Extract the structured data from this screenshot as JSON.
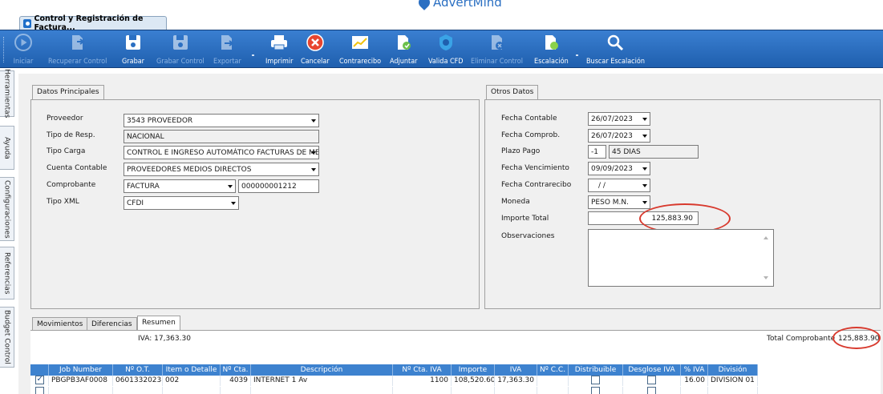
{
  "brand": {
    "logo_text": "AdvertMind"
  },
  "window": {
    "tab_title": "Control y Registración de Factura..."
  },
  "toolbar": {
    "buttons": [
      {
        "label": "Iniciar",
        "icon": "play-icon",
        "enabled": false
      },
      {
        "label": "Recuperar Control",
        "icon": "recover-document-icon",
        "enabled": false
      },
      {
        "label": "Grabar",
        "icon": "save-icon",
        "enabled": true
      },
      {
        "label": "Grabar Control",
        "icon": "save-control-icon",
        "enabled": false
      },
      {
        "label": "Exportar",
        "icon": "export-icon",
        "enabled": false
      },
      {
        "label": "Imprimir",
        "icon": "printer-icon",
        "enabled": true
      },
      {
        "label": "Cancelar",
        "icon": "cancel-icon",
        "enabled": true
      },
      {
        "label": "Contrarecibo",
        "icon": "receipt-chart-icon",
        "enabled": true
      },
      {
        "label": "Adjuntar",
        "icon": "attach-document-icon",
        "enabled": true
      },
      {
        "label": "Valida CFD",
        "icon": "validate-cfd-icon",
        "enabled": true
      },
      {
        "label": "Eliminar Control",
        "icon": "delete-document-icon",
        "enabled": false
      },
      {
        "label": "Escalación",
        "icon": "escalation-icon",
        "enabled": true
      },
      {
        "label": "Buscar Escalación",
        "icon": "search-icon",
        "enabled": true
      }
    ]
  },
  "side_tabs": [
    "Herramientas",
    "Ayuda",
    "Configuraciones",
    "Referencias",
    "Budget Control"
  ],
  "datos_principales": {
    "title": "Datos Principales",
    "proveedor": {
      "label": "Proveedor",
      "value": "3543 PROVEEDOR"
    },
    "tipo_resp": {
      "label": "Tipo de Resp.",
      "value": "NACIONAL"
    },
    "tipo_carga": {
      "label": "Tipo Carga",
      "value": "CONTROL E INGRESO AUTOMÁTICO FACTURAS DE MED"
    },
    "cuenta_contable": {
      "label": "Cuenta Contable",
      "value": "PROVEEDORES MEDIOS DIRECTOS"
    },
    "comprobante": {
      "label": "Comprobante",
      "value": "FACTURA",
      "number": "000000001212"
    },
    "tipo_xml": {
      "label": "Tipo XML",
      "value": "CFDI"
    }
  },
  "otros_datos": {
    "title": "Otros Datos",
    "fecha_contable": {
      "label": "Fecha Contable",
      "value": "26/07/2023"
    },
    "fecha_comprob": {
      "label": "Fecha Comprob.",
      "value": "26/07/2023"
    },
    "plazo_pago": {
      "label": "Plazo Pago",
      "code": "-1",
      "value": "45 DIAS"
    },
    "fecha_vencimiento": {
      "label": "Fecha Vencimiento",
      "value": "09/09/2023"
    },
    "fecha_contrarecibo": {
      "label": "Fecha Contrarecibo",
      "value": "/ /"
    },
    "moneda": {
      "label": "Moneda",
      "value": "PESO M.N."
    },
    "importe_total": {
      "label": "Importe Total",
      "value": "125,883.90"
    },
    "observaciones": {
      "label": "Observaciones",
      "value": ""
    }
  },
  "bottom": {
    "tabs": [
      "Movimientos",
      "Diferencias",
      "Resumen"
    ],
    "iva_summary": "IVA: 17,363.30",
    "total_comprobante_label": "Total Comprobante",
    "total_comprobante_value": "125,883.90"
  },
  "grid": {
    "columns": [
      "Job Number",
      "Nº O.T.",
      "Item o Detalle",
      "Nº Cta.",
      "Descripción",
      "Nº Cta. IVA",
      "Importe",
      "IVA",
      "Nº C.C.",
      "Distribuible",
      "Desglose IVA",
      "% IVA",
      "División"
    ],
    "rows": [
      {
        "checked": true,
        "job_number": "PBGPB3AF0008",
        "ot": "0601332023",
        "item": "002",
        "cta": "4039",
        "descripcion": "INTERNET 1 Av",
        "cta_iva": "1100",
        "importe": "108,520.60",
        "iva": "17,363.30",
        "cc": "",
        "distribuible": false,
        "desglose_iva": false,
        "pct_iva": "16.00",
        "division": "DIVISION 01"
      },
      {
        "checked": false,
        "job_number": "",
        "ot": "",
        "item": "",
        "cta": "",
        "descripcion": "",
        "cta_iva": "",
        "importe": "",
        "iva": "",
        "cc": "",
        "distribuible": false,
        "desglose_iva": false,
        "pct_iva": "",
        "division": ""
      }
    ]
  },
  "colors": {
    "toolbar": "#2a6fc2",
    "grid_header": "#3d82cf",
    "highlight": "#d83a2e"
  }
}
